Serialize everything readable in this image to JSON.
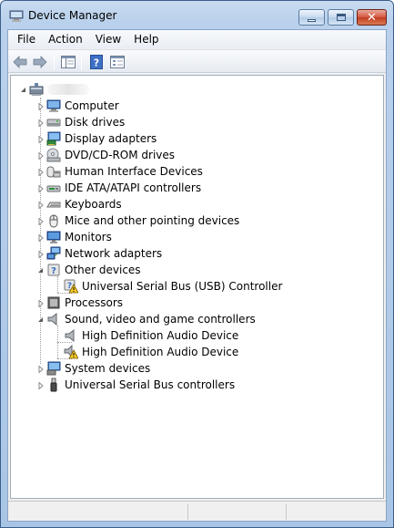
{
  "window": {
    "title": "Device Manager",
    "icon": "device-manager-icon",
    "controls": [
      "minimize",
      "maximize",
      "close"
    ]
  },
  "menu": [
    "File",
    "Action",
    "View",
    "Help"
  ],
  "toolbar": {
    "buttons": [
      "back-arrow-icon",
      "forward-arrow-icon",
      "show-hide-console-tree-icon",
      "help-icon",
      "properties-icon"
    ]
  },
  "tree": {
    "root": {
      "label": "",
      "icon": "computer-root-icon",
      "expanded": true
    },
    "categories": [
      {
        "label": "Computer",
        "icon": "computer-icon",
        "expanded": false
      },
      {
        "label": "Disk drives",
        "icon": "disk-drive-icon",
        "expanded": false
      },
      {
        "label": "Display adapters",
        "icon": "display-adapter-icon",
        "expanded": false
      },
      {
        "label": "DVD/CD-ROM drives",
        "icon": "dvd-drive-icon",
        "expanded": false
      },
      {
        "label": "Human Interface Devices",
        "icon": "hid-icon",
        "expanded": false
      },
      {
        "label": "IDE ATA/ATAPI controllers",
        "icon": "ide-controller-icon",
        "expanded": false
      },
      {
        "label": "Keyboards",
        "icon": "keyboard-icon",
        "expanded": false
      },
      {
        "label": "Mice and other pointing devices",
        "icon": "mouse-icon",
        "expanded": false
      },
      {
        "label": "Monitors",
        "icon": "monitor-icon",
        "expanded": false
      },
      {
        "label": "Network adapters",
        "icon": "network-adapter-icon",
        "expanded": false
      },
      {
        "label": "Other devices",
        "icon": "other-devices-icon",
        "expanded": true,
        "children": [
          {
            "label": "Universal Serial Bus (USB) Controller",
            "icon": "unknown-device-warning-icon"
          }
        ]
      },
      {
        "label": "Processors",
        "icon": "processor-icon",
        "expanded": false
      },
      {
        "label": "Sound, video and game controllers",
        "icon": "speaker-icon",
        "expanded": true,
        "children": [
          {
            "label": "High Definition Audio Device",
            "icon": "audio-device-icon"
          },
          {
            "label": "High Definition Audio Device",
            "icon": "audio-device-warning-icon"
          }
        ]
      },
      {
        "label": "System devices",
        "icon": "system-devices-icon",
        "expanded": false
      },
      {
        "label": "Universal Serial Bus controllers",
        "icon": "usb-icon",
        "expanded": false
      }
    ]
  },
  "status": [
    "",
    "",
    ""
  ]
}
